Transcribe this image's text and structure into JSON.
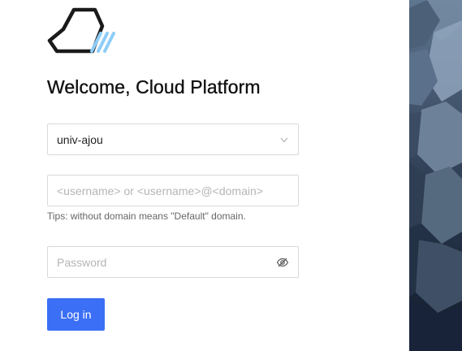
{
  "header": {
    "logo_icon": "cloud-platform-logo",
    "title": "Welcome, Cloud Platform"
  },
  "form": {
    "domain_select": {
      "value": "univ-ajou",
      "icon": "chevron-down-icon"
    },
    "username": {
      "value": "",
      "placeholder": "<username> or <username>@<domain>"
    },
    "tips": "Tips: without domain means \"Default\" domain.",
    "password": {
      "value": "",
      "placeholder": "Password",
      "icon": "eye-off-icon"
    },
    "login_label": "Log in"
  },
  "colors": {
    "primary": "#3b6ff5",
    "logo_accent": "#8ecdf7",
    "border": "#d9d9d9"
  }
}
